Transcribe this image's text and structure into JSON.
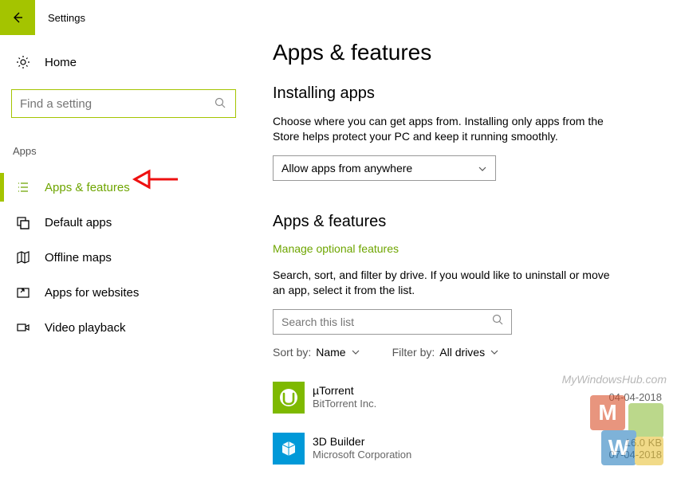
{
  "titlebar": {
    "title": "Settings"
  },
  "sidebar": {
    "home_label": "Home",
    "search_placeholder": "Find a setting",
    "category": "Apps",
    "items": [
      {
        "label": "Apps & features"
      },
      {
        "label": "Default apps"
      },
      {
        "label": "Offline maps"
      },
      {
        "label": "Apps for websites"
      },
      {
        "label": "Video playback"
      }
    ]
  },
  "content": {
    "page_title": "Apps & features",
    "installing_heading": "Installing apps",
    "installing_desc": "Choose where you can get apps from. Installing only apps from the Store helps protect your PC and keep it running smoothly.",
    "install_dropdown_value": "Allow apps from anywhere",
    "apps_heading": "Apps & features",
    "optional_link": "Manage optional features",
    "apps_desc": "Search, sort, and filter by drive. If you would like to uninstall or move an app, select it from the list.",
    "search_list_placeholder": "Search this list",
    "sort_label": "Sort by:",
    "sort_value": "Name",
    "filter_label": "Filter by:",
    "filter_value": "All drives",
    "apps": [
      {
        "name": "µTorrent",
        "publisher": "BitTorrent Inc.",
        "size": "",
        "date": "04-04-2018"
      },
      {
        "name": "3D Builder",
        "publisher": "Microsoft Corporation",
        "size": "16.0 KB",
        "date": "07-04-2018"
      }
    ]
  },
  "watermark": {
    "text": "MyWindowsHub.com"
  }
}
